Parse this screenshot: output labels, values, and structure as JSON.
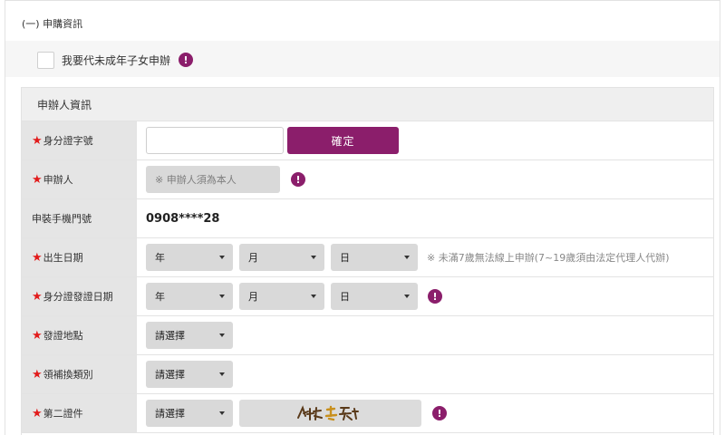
{
  "section": {
    "title": "(一) 申購資訊"
  },
  "minor": {
    "label": "我要代未成年子女申辦",
    "info_icon": "!"
  },
  "panel": {
    "title": "申辦人資訊"
  },
  "required_mark": "★",
  "rows": {
    "id_number": {
      "label": "身分證字號",
      "confirm_label": "確定",
      "value": ""
    },
    "applicant": {
      "label": "申辦人",
      "placeholder": "※ 申辦人須為本人"
    },
    "phone": {
      "label": "申裝手機門號",
      "value": "0908****28"
    },
    "birth": {
      "label": "出生日期",
      "year": "年",
      "month": "月",
      "day": "日",
      "note": "※ 未滿7歲無法線上申辦(7~19歲須由法定代理人代辦)"
    },
    "id_issue_date": {
      "label": "身分證發證日期",
      "year": "年",
      "month": "月",
      "day": "日"
    },
    "issue_place": {
      "label": "發證地點",
      "selected": "請選擇"
    },
    "issue_type": {
      "label": "領補換類別",
      "selected": "請選擇"
    },
    "second_id": {
      "label": "第二證件",
      "selected": "請選擇"
    }
  },
  "icons": {
    "checkbox": "checkbox-icon",
    "info": "exclamation-icon",
    "caret": "chevron-down-icon",
    "required": "required-star-icon"
  },
  "colors": {
    "accent": "#8b1e6b",
    "required": "#e21b1b",
    "label_bg": "#e5e5e5",
    "select_bg": "#d9d9d9"
  }
}
